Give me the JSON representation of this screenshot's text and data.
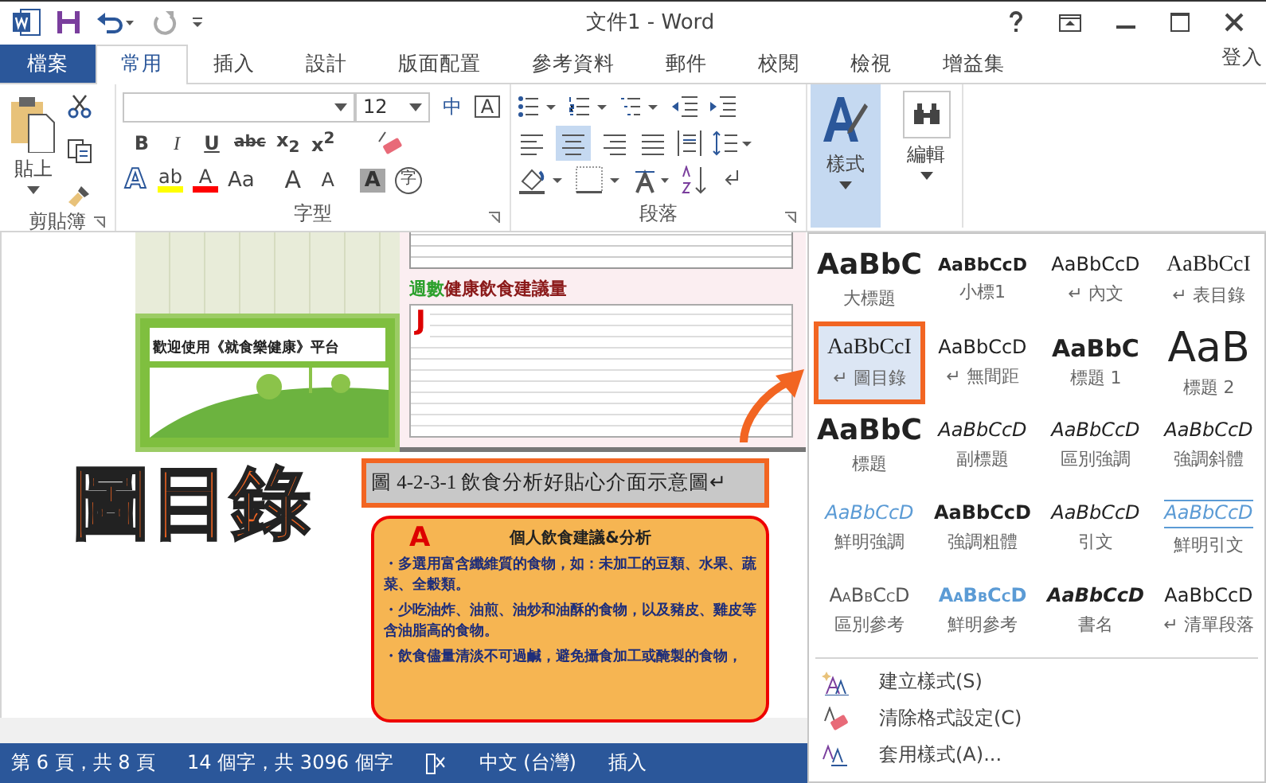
{
  "title_bar": {
    "title": "文件1 - Word"
  },
  "tabs": [
    {
      "label": "檔案",
      "kind": "file",
      "selected": false
    },
    {
      "label": "常用",
      "kind": "tab",
      "selected": true
    },
    {
      "label": "插入",
      "kind": "tab",
      "selected": false
    },
    {
      "label": "設計",
      "kind": "tab",
      "selected": false
    },
    {
      "label": "版面配置",
      "kind": "tab",
      "selected": false
    },
    {
      "label": "參考資料",
      "kind": "tab",
      "selected": false
    },
    {
      "label": "郵件",
      "kind": "tab",
      "selected": false
    },
    {
      "label": "校閱",
      "kind": "tab",
      "selected": false
    },
    {
      "label": "檢視",
      "kind": "tab",
      "selected": false
    },
    {
      "label": "增益集",
      "kind": "tab",
      "selected": false
    }
  ],
  "sign_in": "登入",
  "ribbon": {
    "clipboard": {
      "paste": "貼上",
      "label": "剪貼簿"
    },
    "font": {
      "size": "12",
      "phonetic": "中",
      "border_char": "A",
      "label": "字型",
      "format_buttons": [
        "B",
        "I",
        "U",
        "abc",
        "x$_{2}$",
        "x$^{2}$"
      ],
      "effect_buttons": [
        {
          "glyph": "A",
          "kind": "effect"
        },
        {
          "glyph": "ab",
          "kind": "highlight",
          "color": "#ffff00"
        },
        {
          "glyph": "A",
          "kind": "color",
          "color": "#ff0000"
        },
        {
          "glyph": "Aa",
          "kind": "case"
        },
        {
          "glyph": "A",
          "kind": "grow"
        },
        {
          "glyph": "A",
          "kind": "shrink"
        },
        {
          "glyph": "A",
          "kind": "shading"
        },
        {
          "glyph": "字",
          "kind": "enclose"
        }
      ]
    },
    "paragraph": {
      "label": "段落"
    },
    "styles_button": {
      "label": "樣式",
      "selected": true
    },
    "editing_button": {
      "label": "編輯"
    }
  },
  "document": {
    "card_text": "歡迎使用《就食樂健康》平台",
    "panel_heading_prefix": "週數",
    "panel_heading": "健康飲食建議量",
    "panel_mark": "J",
    "annotation": "圖目錄",
    "caption": "圖 4-2-3-1 飲食分析好貼心介面示意圖↵",
    "advice_title": "個人飲食建議&分析",
    "advice_mark": "A",
    "advice_items": [
      "・多選用富含纖維質的食物，如：未加工的豆類、水果、蔬菜、全穀類。",
      "・少吃油炸、油煎、油炒和油酥的食物，以及豬皮、雞皮等含油脂高的食物。",
      "・飲食儘量清淡不可過鹹，避免攝食加工或醃製的食物，"
    ]
  },
  "styles_gallery": {
    "items": [
      {
        "preview": "AaBbC",
        "label": "大標題",
        "kind": "title",
        "selected": false
      },
      {
        "preview": "AaBbCcD",
        "label": "小標1",
        "kind": "small-bold",
        "selected": false
      },
      {
        "preview": "AaBbCcD",
        "label": "↵ 內文",
        "kind": "normal",
        "selected": false
      },
      {
        "preview": "AaBbCcI",
        "label": "↵ 表目錄",
        "kind": "serif",
        "selected": false
      },
      {
        "preview": "AaBbCcI",
        "label": "↵ 圖目錄",
        "kind": "serif",
        "selected": true
      },
      {
        "preview": "AaBbCcD",
        "label": "↵ 無間距",
        "kind": "normal",
        "selected": false
      },
      {
        "preview": "AaBbC",
        "label": "標題 1",
        "kind": "heading1",
        "selected": false
      },
      {
        "preview": "AaB",
        "label": "標題 2",
        "kind": "heading2",
        "selected": false
      },
      {
        "preview": "AaBbC",
        "label": "標題",
        "kind": "title",
        "selected": false
      },
      {
        "preview": "AaBbCcD",
        "label": "副標題",
        "kind": "emphasis",
        "selected": false
      },
      {
        "preview": "AaBbCcD",
        "label": "區別強調",
        "kind": "emphasis",
        "selected": false
      },
      {
        "preview": "AaBbCcD",
        "label": "強調斜體",
        "kind": "emphasis",
        "selected": false
      },
      {
        "preview": "AaBbCcD",
        "label": "鮮明強調",
        "kind": "intense-emphasis",
        "selected": false
      },
      {
        "preview": "AaBbCcD",
        "label": "強調粗體",
        "kind": "strong",
        "selected": false
      },
      {
        "preview": "AaBbCcD",
        "label": "引文",
        "kind": "emphasis",
        "selected": false
      },
      {
        "preview": "AaBbCcD",
        "label": "鮮明引文",
        "kind": "intense-quote",
        "selected": false
      },
      {
        "preview": "AaBbCcD",
        "label": "區別參考",
        "kind": "subtle-reference",
        "selected": false
      },
      {
        "preview": "AaBbCcD",
        "label": "鮮明參考",
        "kind": "intense-reference",
        "selected": false
      },
      {
        "preview": "AaBbCcD",
        "label": "書名",
        "kind": "book",
        "selected": false
      },
      {
        "preview": "AaBbCcD",
        "label": "↵ 清單段落",
        "kind": "normal",
        "selected": false
      }
    ]
  },
  "styles_menu": [
    {
      "label": "建立樣式(S)",
      "kind": "create"
    },
    {
      "label": "清除格式設定(C)",
      "kind": "clear"
    },
    {
      "label": "套用樣式(A)...",
      "kind": "apply"
    }
  ],
  "status_bar": {
    "page": "第 6 頁，共 8 頁",
    "words": "14 個字，共 3096 個字",
    "language": "中文 (台灣)",
    "mode": "插入"
  }
}
